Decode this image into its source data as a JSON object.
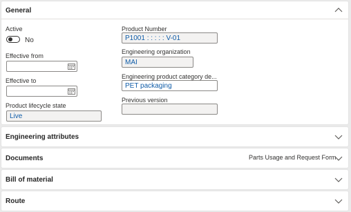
{
  "general": {
    "title": "General",
    "active_label": "Active",
    "active_value": "No",
    "effective_from_label": "Effective from",
    "effective_from_value": "",
    "effective_to_label": "Effective to",
    "effective_to_value": "",
    "lifecycle_label": "Product lifecycle state",
    "lifecycle_value": "Live",
    "product_number_label": "Product Number",
    "product_number_value": "P1001 : : : : : V-01",
    "eng_org_label": "Engineering organization",
    "eng_org_value": "MAI",
    "eng_category_label": "Engineering product category de...",
    "eng_category_value": "PET packaging",
    "previous_version_label": "Previous version",
    "previous_version_value": ""
  },
  "sections": {
    "engineering_attributes": "Engineering attributes",
    "documents": "Documents",
    "documents_summary": "Parts Usage and Request Form",
    "bill_of_material": "Bill of material",
    "route": "Route"
  },
  "icons": {
    "expanded": "chevron-up-icon",
    "collapsed": "chevron-down-icon",
    "calendar": "calendar-icon"
  },
  "colors": {
    "value_text": "#0f5ca8",
    "background": "#eaeaea"
  }
}
